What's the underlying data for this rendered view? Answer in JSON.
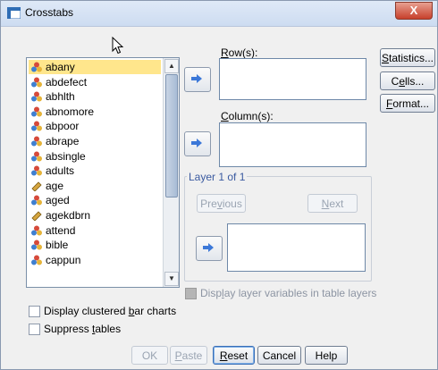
{
  "window": {
    "title": "Crosstabs",
    "close_glyph": "X"
  },
  "variables": [
    {
      "name": "abany",
      "type": "nominal",
      "selected": true
    },
    {
      "name": "abdefect",
      "type": "nominal"
    },
    {
      "name": "abhlth",
      "type": "nominal"
    },
    {
      "name": "abnomore",
      "type": "nominal"
    },
    {
      "name": "abpoor",
      "type": "nominal"
    },
    {
      "name": "abrape",
      "type": "nominal"
    },
    {
      "name": "absingle",
      "type": "nominal"
    },
    {
      "name": "adults",
      "type": "nominal"
    },
    {
      "name": "age",
      "type": "scale"
    },
    {
      "name": "aged",
      "type": "nominal"
    },
    {
      "name": "agekdbrn",
      "type": "scale"
    },
    {
      "name": "attend",
      "type": "nominal"
    },
    {
      "name": "bible",
      "type": "nominal"
    },
    {
      "name": "cappun",
      "type": "nominal"
    }
  ],
  "fields": {
    "rows_label": "Row(s):",
    "columns_label": "Column(s):",
    "layer_title": "Layer 1 of 1"
  },
  "buttons": {
    "previous": "Previous",
    "next": "Next",
    "statistics": "Statistics...",
    "cells": "Cells...",
    "format": "Format...",
    "ok": "OK",
    "paste": "Paste",
    "reset": "Reset",
    "cancel": "Cancel",
    "help": "Help"
  },
  "options": {
    "display_layer": "Display layer variables in table layers",
    "display_clustered": "Display clustered bar charts",
    "suppress_tables": "Suppress tables"
  },
  "colors": {
    "selection": "#ffe68c",
    "nominal_icon_a": "#d64a3a",
    "nominal_icon_b": "#3f7fd0",
    "nominal_icon_c": "#e6b43a",
    "scale_icon": "#d6a640",
    "arrow": "#3c78d8"
  }
}
